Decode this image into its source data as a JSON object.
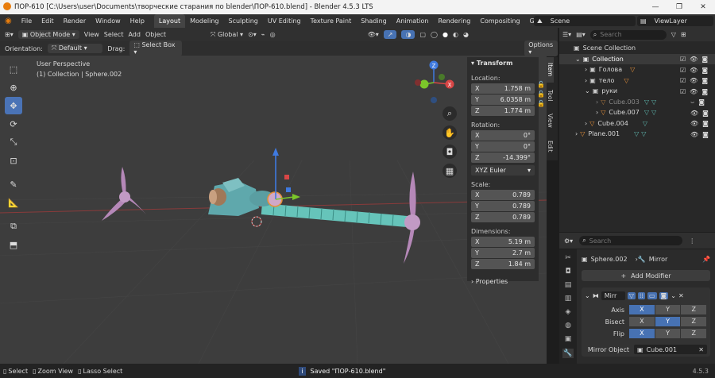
{
  "window": {
    "title": "ПОР-610 [C:\\Users\\user\\Documents\\творческие старания по blender\\ПОР-610.blend] - Blender 4.5.3 LTS"
  },
  "menu": [
    "File",
    "Edit",
    "Render",
    "Window",
    "Help"
  ],
  "workspaces": [
    "Layout",
    "Modeling",
    "Sculpting",
    "UV Editing",
    "Texture Paint",
    "Shading",
    "Animation",
    "Rendering",
    "Compositing",
    "Geome"
  ],
  "scene": {
    "label": "Scene",
    "viewlayer": "ViewLayer"
  },
  "viewport_header": {
    "mode": "Object Mode",
    "menus": [
      "View",
      "Select",
      "Add",
      "Object"
    ],
    "transform": "Global"
  },
  "tool_settings": {
    "orientation_label": "Orientation:",
    "orientation": "Default",
    "drag_label": "Drag:",
    "drag": "Select Box",
    "options": "Options"
  },
  "viewport": {
    "perspective": "User Perspective",
    "collection": "(1) Collection | Sphere.002"
  },
  "gizmo_axes": {
    "x": "X",
    "y": "Y",
    "z": "Z"
  },
  "npanel": {
    "transform_title": "Transform",
    "location_label": "Location:",
    "location": [
      {
        "axis": "X",
        "value": "1.758 m"
      },
      {
        "axis": "Y",
        "value": "6.0358 m"
      },
      {
        "axis": "Z",
        "value": "1.774 m"
      }
    ],
    "rotation_label": "Rotation:",
    "rotation": [
      {
        "axis": "X",
        "value": "0°"
      },
      {
        "axis": "Y",
        "value": "0°"
      },
      {
        "axis": "Z",
        "value": "-14.399°"
      }
    ],
    "rotation_mode": "XYZ Euler",
    "scale_label": "Scale:",
    "scale": [
      {
        "axis": "X",
        "value": "0.789"
      },
      {
        "axis": "Y",
        "value": "0.789"
      },
      {
        "axis": "Z",
        "value": "0.789"
      }
    ],
    "dimensions_label": "Dimensions:",
    "dimensions": [
      {
        "axis": "X",
        "value": "5.19 m"
      },
      {
        "axis": "Y",
        "value": "2.7 m"
      },
      {
        "axis": "Z",
        "value": "1.84 m"
      }
    ],
    "properties_title": "Properties",
    "tabs": [
      "Item",
      "Tool",
      "View",
      "Edit"
    ]
  },
  "outliner": {
    "search_placeholder": "Search",
    "scene_collection": "Scene Collection",
    "items": [
      {
        "name": "Collection",
        "depth": 1
      },
      {
        "name": "Голова",
        "depth": 2
      },
      {
        "name": "тело",
        "depth": 2
      },
      {
        "name": "руки",
        "depth": 2
      },
      {
        "name": "Cube.003",
        "depth": 3
      },
      {
        "name": "Cube.007",
        "depth": 3
      },
      {
        "name": "Cube.004",
        "depth": 2
      },
      {
        "name": "Plane.001",
        "depth": 1
      }
    ]
  },
  "properties": {
    "search_placeholder": "Search",
    "object": "Sphere.002",
    "modifier_crumb": "Mirror",
    "add_modifier": "Add Modifier",
    "modifier_name": "Mirr",
    "axis_label": "Axis",
    "bisect_label": "Bisect",
    "flip_label": "Flip",
    "xyz": [
      "X",
      "Y",
      "Z"
    ],
    "mirror_object_label": "Mirror Object",
    "mirror_object": "Cube.001"
  },
  "statusbar": {
    "select": "Select",
    "zoom": "Zoom View",
    "lasso": "Lasso Select",
    "saved": "Saved \"ПОР-610.blend\"",
    "version": "4.5.3"
  },
  "colors": {
    "accent": "#4772b3",
    "header": "#303030",
    "viewport": "#3d3d3d",
    "panel": "#2d2d2d",
    "orange": "#e6913a",
    "teal": "#5fb8b0"
  }
}
